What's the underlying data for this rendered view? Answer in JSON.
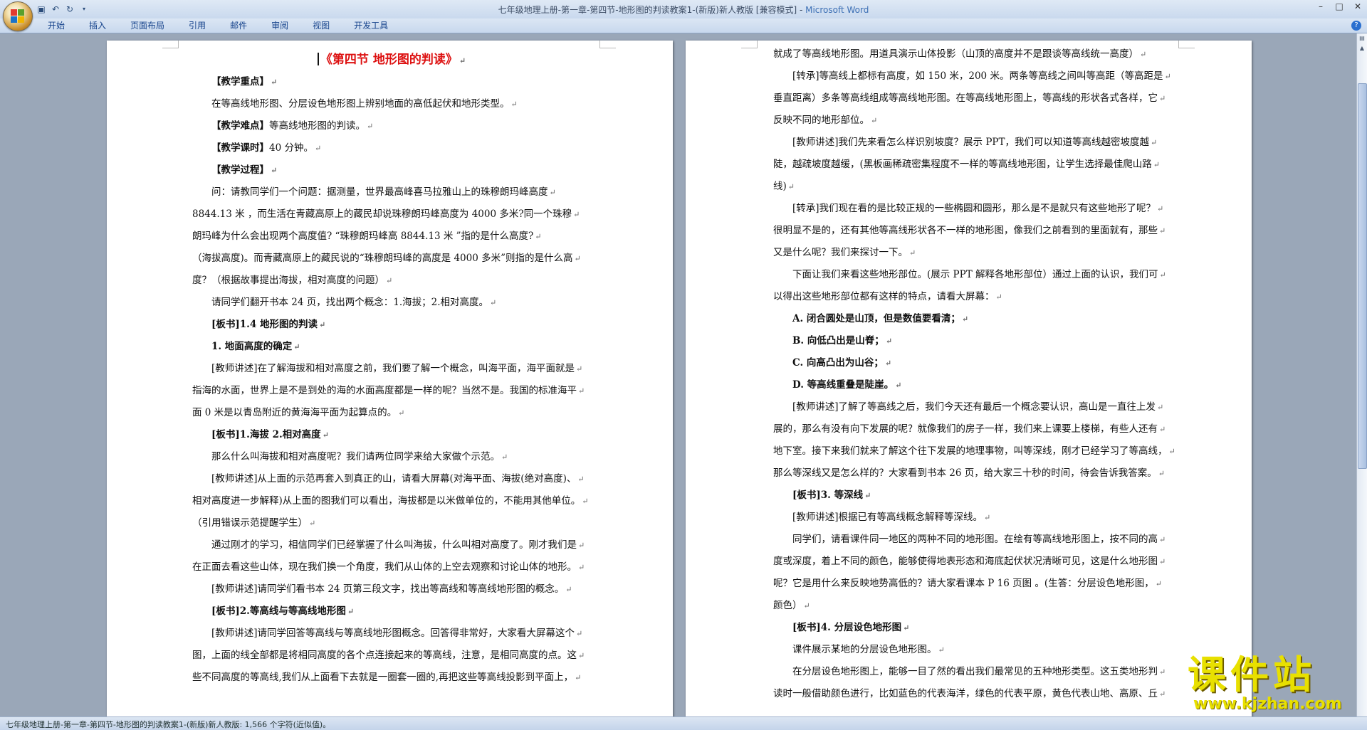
{
  "window": {
    "title_doc": "七年级地理上册-第一章-第四节-地形图的判读教案1-(新版)新人教版 [兼容模式]",
    "title_sep": " - ",
    "title_app": "Microsoft Word"
  },
  "ribbon": {
    "tabs": [
      "开始",
      "插入",
      "页面布局",
      "引用",
      "邮件",
      "审阅",
      "视图",
      "开发工具"
    ]
  },
  "pages": {
    "left": [
      {
        "text": "《第四节  地形图的判读》",
        "style": "title"
      },
      {
        "text": "【教学重点】",
        "style": "bold-indent"
      },
      {
        "text": "在等高线地形图、分层设色地形图上辨别地面的高低起伏和地形类型。",
        "style": "indent"
      },
      {
        "text": "【教学难点】等高线地形图的判读。",
        "style": "indent",
        "bold_prefix": "【教学难点】"
      },
      {
        "text": "【教学课时】40 分钟。",
        "style": "indent",
        "bold_prefix": "【教学课时】"
      },
      {
        "text": "【教学过程】",
        "style": "bold-indent"
      },
      {
        "text": "问：请教同学们一个问题：据测量，世界最高峰喜马拉雅山上的珠穆朗玛峰高度",
        "style": "indent"
      },
      {
        "text": "8844.13 米  ，而生活在青藏高原上的藏民却说珠穆朗玛峰高度为 4000 多米?同一个珠穆",
        "style": "plain"
      },
      {
        "text": "朗玛峰为什么会出现两个高度值?    “珠穆朗玛峰高   8844.13 米   ”指的是什么高度?",
        "style": "plain"
      },
      {
        "text": "（海拔高度)。而青藏高原上的藏民说的“珠穆朗玛峰的高度是 4000 多米”则指的是什么高",
        "style": "plain"
      },
      {
        "text": "度？（根据故事提出海拔，相对高度的问题）",
        "style": "plain"
      },
      {
        "text": "请同学们翻开书本 24 页，找出两个概念：1.海拔；2.相对高度。",
        "style": "indent"
      },
      {
        "text": "[板书]1.4 地形图的判读",
        "style": "bold-indent"
      },
      {
        "text": "1. 地面高度的确定",
        "style": "bold-indent"
      },
      {
        "text": "[教师讲述]在了解海拔和相对高度之前，我们要了解一个概念，叫海平面，海平面就是",
        "style": "indent"
      },
      {
        "text": "指海的水面，世界上是不是到处的海的水面高度都是一样的呢？当然不是。我国的标准海平",
        "style": "plain"
      },
      {
        "text": "面 0 米是以青岛附近的黄海海平面为起算点的。",
        "style": "plain"
      },
      {
        "text": "[板书]1.海拔 2.相对高度",
        "style": "bold-indent"
      },
      {
        "text": "那么什么叫海拔和相对高度呢？我们请两位同学来给大家做个示范。",
        "style": "indent"
      },
      {
        "text": "[教师讲述]从上面的示范再套入到真正的山，请看大屏幕(对海平面、海拔(绝对高度)、",
        "style": "indent"
      },
      {
        "text": "相对高度进一步解释)从上面的图我们可以看出，海拔都是以米做单位的，不能用其他单位。",
        "style": "plain"
      },
      {
        "text": "（引用错误示范提醒学生）",
        "style": "plain"
      },
      {
        "text": "通过刚才的学习，相信同学们已经掌握了什么叫海拔，什么叫相对高度了。刚才我们是",
        "style": "indent"
      },
      {
        "text": "在正面去看这些山体，现在我们换一个角度，我们从山体的上空去观察和讨论山体的地形。",
        "style": "plain"
      },
      {
        "text": "[教师讲述]请同学们看书本 24 页第三段文字，找出等高线和等高线地形图的概念。",
        "style": "indent"
      },
      {
        "text": "[板书]2.等高线与等高线地形图",
        "style": "bold-indent"
      },
      {
        "text": "[教师讲述]请同学回答等高线与等高线地形图概念。回答得非常好，大家看大屏幕这个",
        "style": "indent"
      },
      {
        "text": "图，上面的线全部都是将相同高度的各个点连接起来的等高线，注意，是相同高度的点。这",
        "style": "plain"
      },
      {
        "text": "些不同高度的等高线,我们从上面看下去就是一圈套一圈的,再把这些等高线投影到平面上，",
        "style": "plain"
      }
    ],
    "right": [
      {
        "text": "就成了等高线地形图。用道具演示山体投影（山顶的高度并不是跟谈等高线统一高度）",
        "style": "plain"
      },
      {
        "text": "[转承]等高线上都标有高度，如 150 米，200 米。两条等高线之间叫等高距（等高距是",
        "style": "indent"
      },
      {
        "text": "垂直距离）多条等高线组成等高线地形图。在等高线地形图上，等高线的形状各式各样，它",
        "style": "plain"
      },
      {
        "text": "反映不同的地形部位。",
        "style": "plain"
      },
      {
        "text": "[教师讲述]我们先来看怎么样识别坡度？展示 PPT，我们可以知道等高线越密坡度越",
        "style": "indent"
      },
      {
        "text": "陡，越疏坡度越缓，(黑板画稀疏密集程度不一样的等高线地形图，让学生选择最佳爬山路",
        "style": "plain"
      },
      {
        "text": "线)",
        "style": "plain"
      },
      {
        "text": "[转承]我们现在看的是比较正规的一些椭圆和圆形，那么是不是就只有这些地形了呢？",
        "style": "indent"
      },
      {
        "text": "很明显不是的，还有其他等高线形状各不一样的地形图，像我们之前看到的里面就有，那些",
        "style": "plain"
      },
      {
        "text": "又是什么呢？我们来探讨一下。",
        "style": "plain"
      },
      {
        "text": "下面让我们来看这些地形部位。(展示 PPT 解释各地形部位）通过上面的认识，我们可",
        "style": "indent"
      },
      {
        "text": "以得出这些地形部位都有这样的特点，请看大屏幕：",
        "style": "plain"
      },
      {
        "text": "A. 闭合圆处是山顶，但是数值要看清；",
        "style": "bold-indent"
      },
      {
        "text": "B. 向低凸出是山脊；",
        "style": "bold-indent"
      },
      {
        "text": "C. 向高凸出为山谷；",
        "style": "bold-indent"
      },
      {
        "text": "D. 等高线重叠是陡崖。",
        "style": "bold-indent"
      },
      {
        "text": "[教师讲述]了解了等高线之后，我们今天还有最后一个概念要认识，高山是一直往上发",
        "style": "indent"
      },
      {
        "text": "展的，那么有没有向下发展的呢？就像我们的房子一样，我们来上课要上楼梯，有些人还有",
        "style": "plain"
      },
      {
        "text": "地下室。接下来我们就来了解这个往下发展的地理事物，叫等深线，刚才已经学习了等高线，",
        "style": "plain"
      },
      {
        "text": "那么等深线又是怎么样的？大家看到书本 26 页，给大家三十秒的时间，待会告诉我答案。",
        "style": "plain"
      },
      {
        "text": "[板书]3. 等深线",
        "style": "bold-indent"
      },
      {
        "text": "[教师讲述]根据已有等高线概念解释等深线。",
        "style": "indent"
      },
      {
        "text": "同学们，请看课件同一地区的两种不同的地形图。在绘有等高线地形图上，按不同的高",
        "style": "indent"
      },
      {
        "text": "度或深度，着上不同的颜色，能够使得地表形态和海底起伏状况清晰可见，这是什么地形图",
        "style": "plain"
      },
      {
        "text": "呢？它是用什么来反映地势高低的？请大家看课本 P 16 页图 。(生答：分层设色地形图，",
        "style": "plain"
      },
      {
        "text": "颜色）",
        "style": "plain"
      },
      {
        "text": "[板书]4. 分层设色地形图",
        "style": "bold-indent"
      },
      {
        "text": "课件展示某地的分层设色地形图。",
        "style": "indent"
      },
      {
        "text": "在分层设色地形图上，能够一目了然的看出我们最常见的五种地形类型。这五类地形判",
        "style": "indent"
      },
      {
        "text": "读时一般借助颜色进行，比如蓝色的代表海洋，绿色的代表平原，黄色代表山地、高原、丘",
        "style": "plain"
      }
    ]
  },
  "status": {
    "text": "七年级地理上册-第一章-第四节-地形图的判读教案1-(新版)新人教版: 1,566 个字符(近似值)。"
  },
  "watermark": {
    "main": "课件站",
    "url": "www.kjzhan.com"
  },
  "colors": {
    "title_red": "#d11111",
    "watermark_yellow": "#e8e000",
    "app_name_blue": "#3c6fb4"
  }
}
